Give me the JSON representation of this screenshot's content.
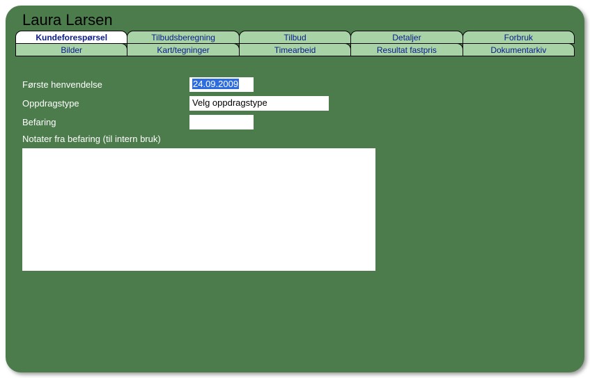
{
  "title": "Laura Larsen",
  "tabs": {
    "row1": [
      {
        "label": "Kundeforespørsel",
        "active": true
      },
      {
        "label": "Tilbudsberegning",
        "active": false
      },
      {
        "label": "Tilbud",
        "active": false
      },
      {
        "label": "Detaljer",
        "active": false
      },
      {
        "label": "Forbruk",
        "active": false
      }
    ],
    "row2": [
      {
        "label": "Bilder",
        "active": false
      },
      {
        "label": "Kart/tegninger",
        "active": false
      },
      {
        "label": "Timearbeid",
        "active": false
      },
      {
        "label": "Resultat fastpris",
        "active": false
      },
      {
        "label": "Dokumentarkiv",
        "active": false
      }
    ]
  },
  "form": {
    "first_contact_label": "Første henvendelse",
    "first_contact_value": "24.09.2009",
    "assignment_type_label": "Oppdragstype",
    "assignment_type_value": "Velg oppdragstype",
    "inspection_label": "Befaring",
    "inspection_value": "",
    "notes_label": "Notater fra befaring (til intern bruk)",
    "notes_value": ""
  }
}
